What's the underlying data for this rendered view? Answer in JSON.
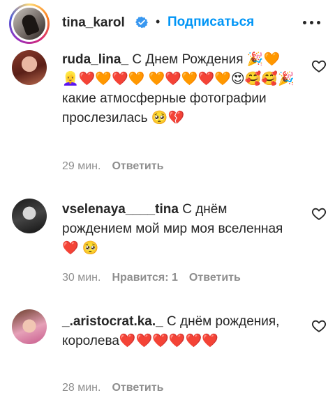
{
  "header": {
    "username": "tina_karol",
    "verified": true,
    "separator": "•",
    "follow_label": "Подписаться"
  },
  "comments": [
    {
      "author": "ruda_lina_",
      "text": "С Днем Рождения 🎉🧡👱‍♀️❤️🧡❤️🧡 🧡❤️🧡❤️🧡😍🥰🥰🎉какие атмосферные фотографии прослезилась 🥺💔",
      "time": "29 мин.",
      "reply_label": "Ответить"
    },
    {
      "author": "vselenaya____tina",
      "text": "С днём рождением мой мир моя вселенная ❤️ 🥺",
      "time": "30 мин.",
      "likes_label": "Нравится: 1",
      "reply_label": "Ответить"
    },
    {
      "author": "_.aristocrat.ka._",
      "text": "С днём рождения, королева❤️❤️❤️❤️❤️❤️",
      "time": "28 мин.",
      "reply_label": "Ответить"
    }
  ],
  "colors": {
    "link_blue": "#0095f6",
    "text_primary": "#262626",
    "text_secondary": "#8e8e8e"
  },
  "icons": [
    "verified-badge-icon",
    "more-options-icon",
    "heart-outline-icon"
  ]
}
